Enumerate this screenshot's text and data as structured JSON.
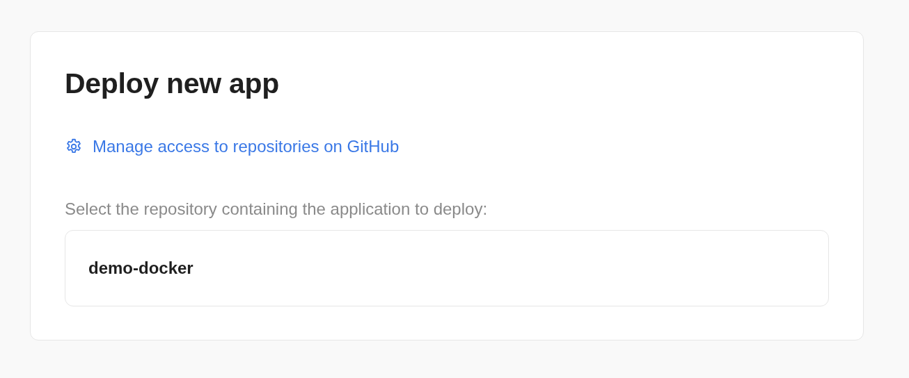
{
  "card": {
    "title": "Deploy new app",
    "manage_link": {
      "label": "Manage access to repositories on GitHub"
    },
    "repository_prompt": "Select the repository containing the application to deploy:",
    "repositories": [
      {
        "name": "demo-docker"
      }
    ]
  }
}
